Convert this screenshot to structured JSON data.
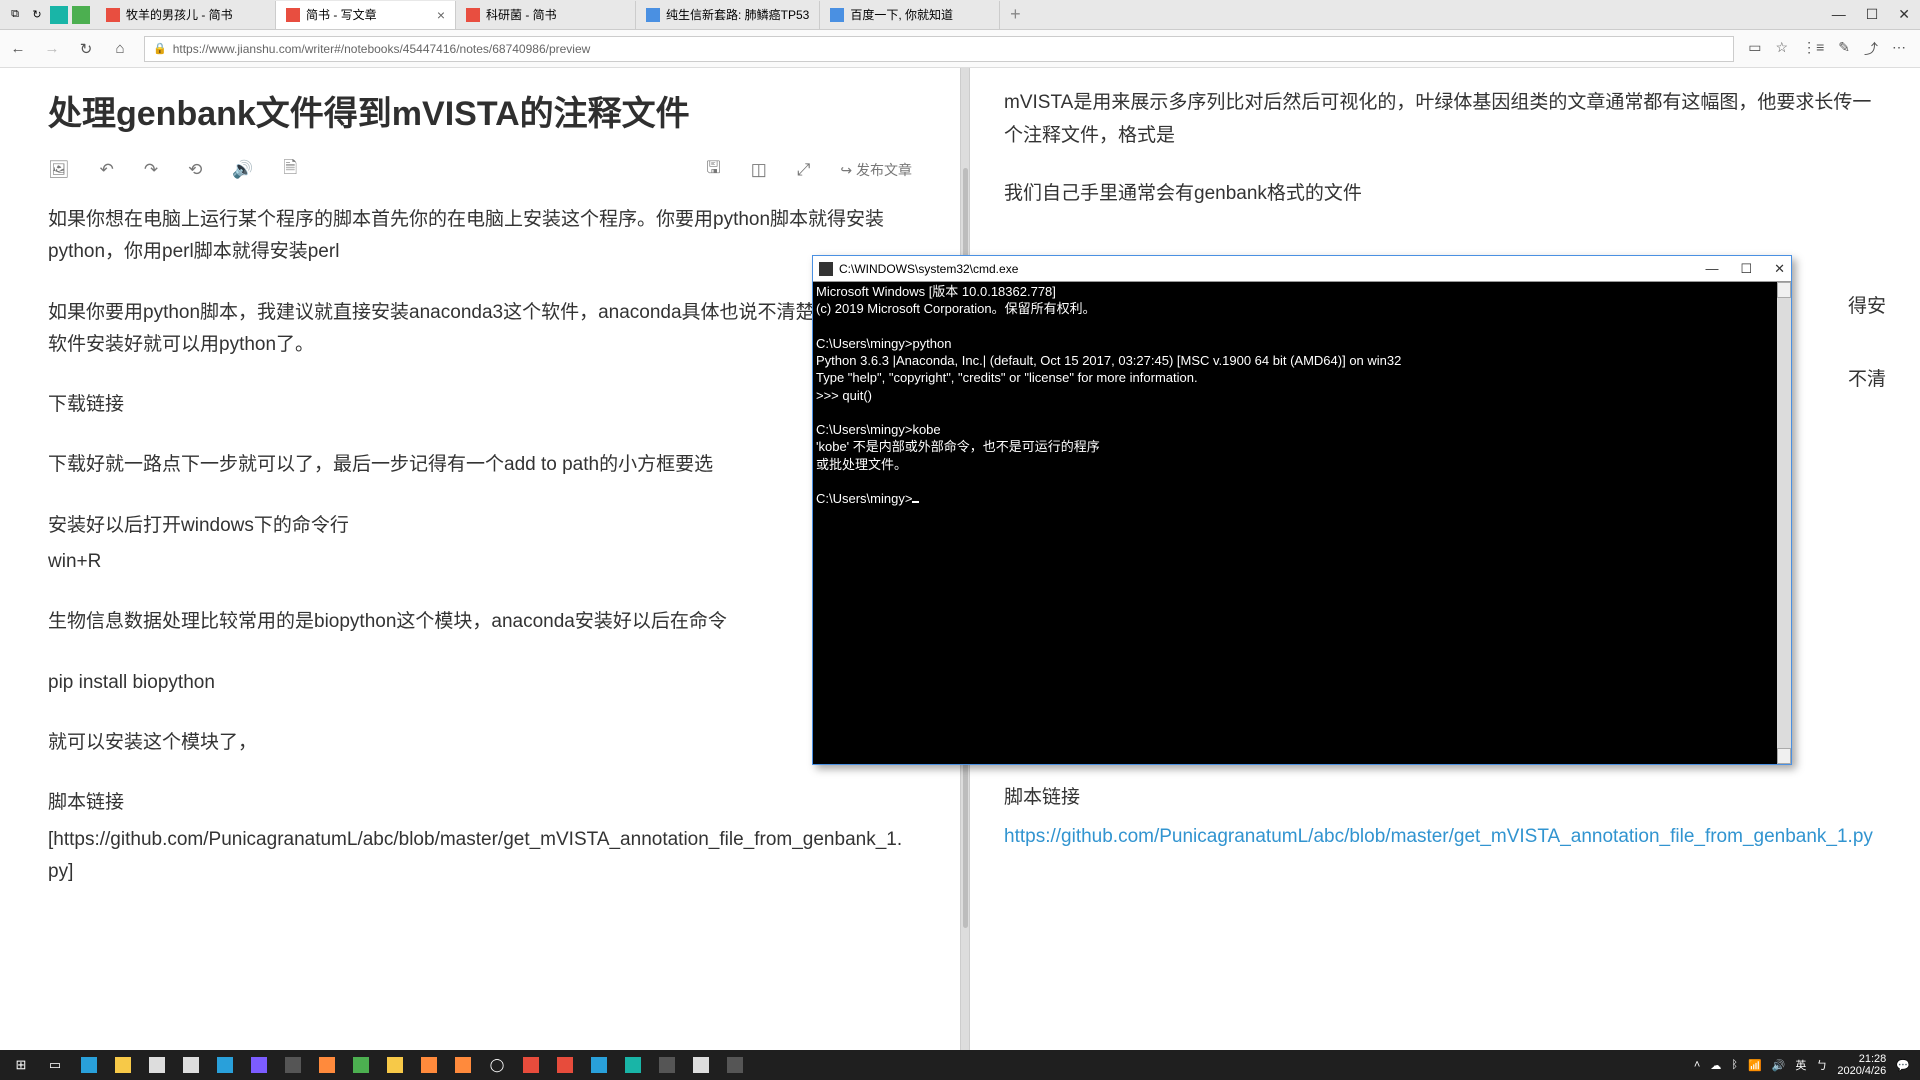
{
  "tabs": [
    {
      "label": "牧羊的男孩儿 - 简书"
    },
    {
      "label": "简书 - 写文章"
    },
    {
      "label": "科研菌 - 简书"
    },
    {
      "label": "纯生信新套路: 肺鳞癌TP53"
    },
    {
      "label": "百度一下, 你就知道"
    }
  ],
  "url": "https://www.jianshu.com/writer#/notebooks/45447416/notes/68740986/preview",
  "win": {
    "min": "—",
    "max": "☐",
    "close": "✕"
  },
  "editor": {
    "title": "处理genbank文件得到mVISTA的注释文件",
    "publish": "↪ 发布文章",
    "p1": "如果你想在电脑上运行某个程序的脚本首先你的在电脑上安装这个程序。你要用python脚本就得安装python，你用perl脚本就得安装perl",
    "p2": "如果你要用python脚本，我建议就直接安装anaconda3这个软件，anaconda具体也说不清楚，反正这个软件安装好就可以用python了。",
    "p3": "下载链接",
    "p4": "下载好就一路点下一步就可以了，最后一步记得有一个add to path的小方框要选",
    "p5": "安装好以后打开windows下的命令行",
    "p6": "win+R",
    "p7": "生物信息数据处理比较常用的是biopython这个模块，anaconda安装好以后在命令",
    "p8": "pip install biopython",
    "p9": "就可以安装这个模块了，",
    "p10": "脚本链接",
    "p11": "[https://github.com/PunicagranatumL/abc/blob/master/get_mVISTA_annotation_file_from_genbank_1.py]"
  },
  "preview": {
    "p1": "mVISTA是用来展示多序列比对后然后可视化的，叶绿体基因组类的文章通常都有这幅图，他要求长传一个注释文件，格式是",
    "p2": "我们自己手里通常会有genbank格式的文件",
    "cut1": "得安",
    "cut2": "不清",
    "p3": "pip install biopython",
    "p4": "就可以安装这个模块了，",
    "p5": "脚本链接",
    "link": "https://github.com/PunicagranatumL/abc/blob/master/get_mVISTA_annotation_file_from_genbank_1.py"
  },
  "cmd": {
    "title": "C:\\WINDOWS\\system32\\cmd.exe",
    "lines": "Microsoft Windows [版本 10.0.18362.778]\n(c) 2019 Microsoft Corporation。保留所有权利。\n\nC:\\Users\\mingy>python\nPython 3.6.3 |Anaconda, Inc.| (default, Oct 15 2017, 03:27:45) [MSC v.1900 64 bit (AMD64)] on win32\nType \"help\", \"copyright\", \"credits\" or \"license\" for more information.\n>>> quit()\n\nC:\\Users\\mingy>kobe\n'kobe' 不是内部或外部命令，也不是可运行的程序\n或批处理文件。\n\nC:\\Users\\mingy>"
  },
  "clock": {
    "time": "21:28",
    "date": "2020/4/26"
  },
  "ime": {
    "lang": "英",
    "input": "ㄅ"
  }
}
